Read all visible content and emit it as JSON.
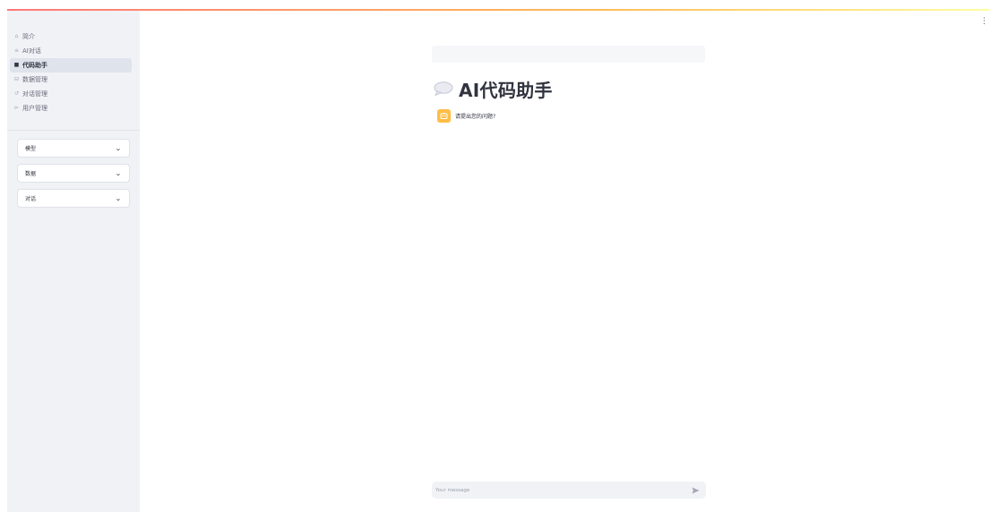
{
  "sidebar": {
    "nav": [
      {
        "label": "简介",
        "icon": "home-icon",
        "active": false
      },
      {
        "label": "AI对话",
        "icon": "chat-icon",
        "active": false
      },
      {
        "label": "代码助手",
        "icon": "chat-bubble-icon",
        "active": true
      },
      {
        "label": "数据管理",
        "icon": "database-icon",
        "active": false
      },
      {
        "label": "对话管理",
        "icon": "history-icon",
        "active": false
      },
      {
        "label": "用户管理",
        "icon": "user-icon",
        "active": false
      }
    ],
    "expanders": [
      {
        "label": "模型"
      },
      {
        "label": "数据"
      },
      {
        "label": "对话"
      }
    ]
  },
  "main": {
    "title": "AI代码助手",
    "title_icon": "speech-balloon-icon",
    "messages": [
      {
        "role": "assistant",
        "avatar": "assistant-avatar-icon",
        "text": "请提出您的问题?"
      }
    ]
  },
  "chat_input": {
    "placeholder": "Your message",
    "value": ""
  },
  "colors": {
    "sidebar_bg": "#f0f2f6",
    "accent_red": "#ff4b4b",
    "avatar_bg": "#ffbd45"
  }
}
